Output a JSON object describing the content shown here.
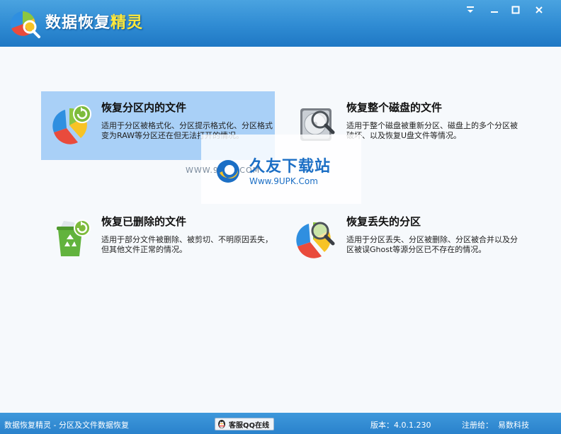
{
  "window": {
    "title_main": "数据恢复",
    "title_highlight": "精灵",
    "buttons": {
      "menu": "menu",
      "minimize": "minimize",
      "maximize": "maximize",
      "close": "close"
    }
  },
  "options": [
    {
      "title": "恢复分区内的文件",
      "description": "适用于分区被格式化、分区提示格式化、分区格式变为RAW等分区还在但无法打开的情况。",
      "icon": "partition-pie-restore-icon",
      "selected": true
    },
    {
      "title": "恢复整个磁盘的文件",
      "description": "适用于整个磁盘被重新分区、磁盘上的多个分区被破坏、以及恢复U盘文件等情况。",
      "icon": "disk-magnifier-icon",
      "selected": false
    },
    {
      "title": "恢复已删除的文件",
      "description": "适用于部分文件被删除、被剪切、不明原因丢失，但其他文件正常的情况。",
      "icon": "recycle-bin-restore-icon",
      "selected": false
    },
    {
      "title": "恢复丢失的分区",
      "description": "适用于分区丢失、分区被删除、分区被合并以及分区被误Ghost等源分区已不存在的情况。",
      "icon": "partition-magnifier-icon",
      "selected": false
    }
  ],
  "watermark": {
    "url_left": "WWW.9UPK.COM",
    "name": "久友下载站",
    "url": "Www.9UPK.Com"
  },
  "statusbar": {
    "app_info": "数据恢复精灵 - 分区及文件数据恢复",
    "qq_button": "客服QQ在线",
    "version": "版本：4.0.1.230",
    "reg_label": "注册给：",
    "reg_value": "易数科技"
  },
  "colors": {
    "titlebar": "#2f8bd3",
    "title_highlight": "#ffe83a",
    "selected_option": "#a9d0f7",
    "statusbar": "#2a82cc"
  }
}
